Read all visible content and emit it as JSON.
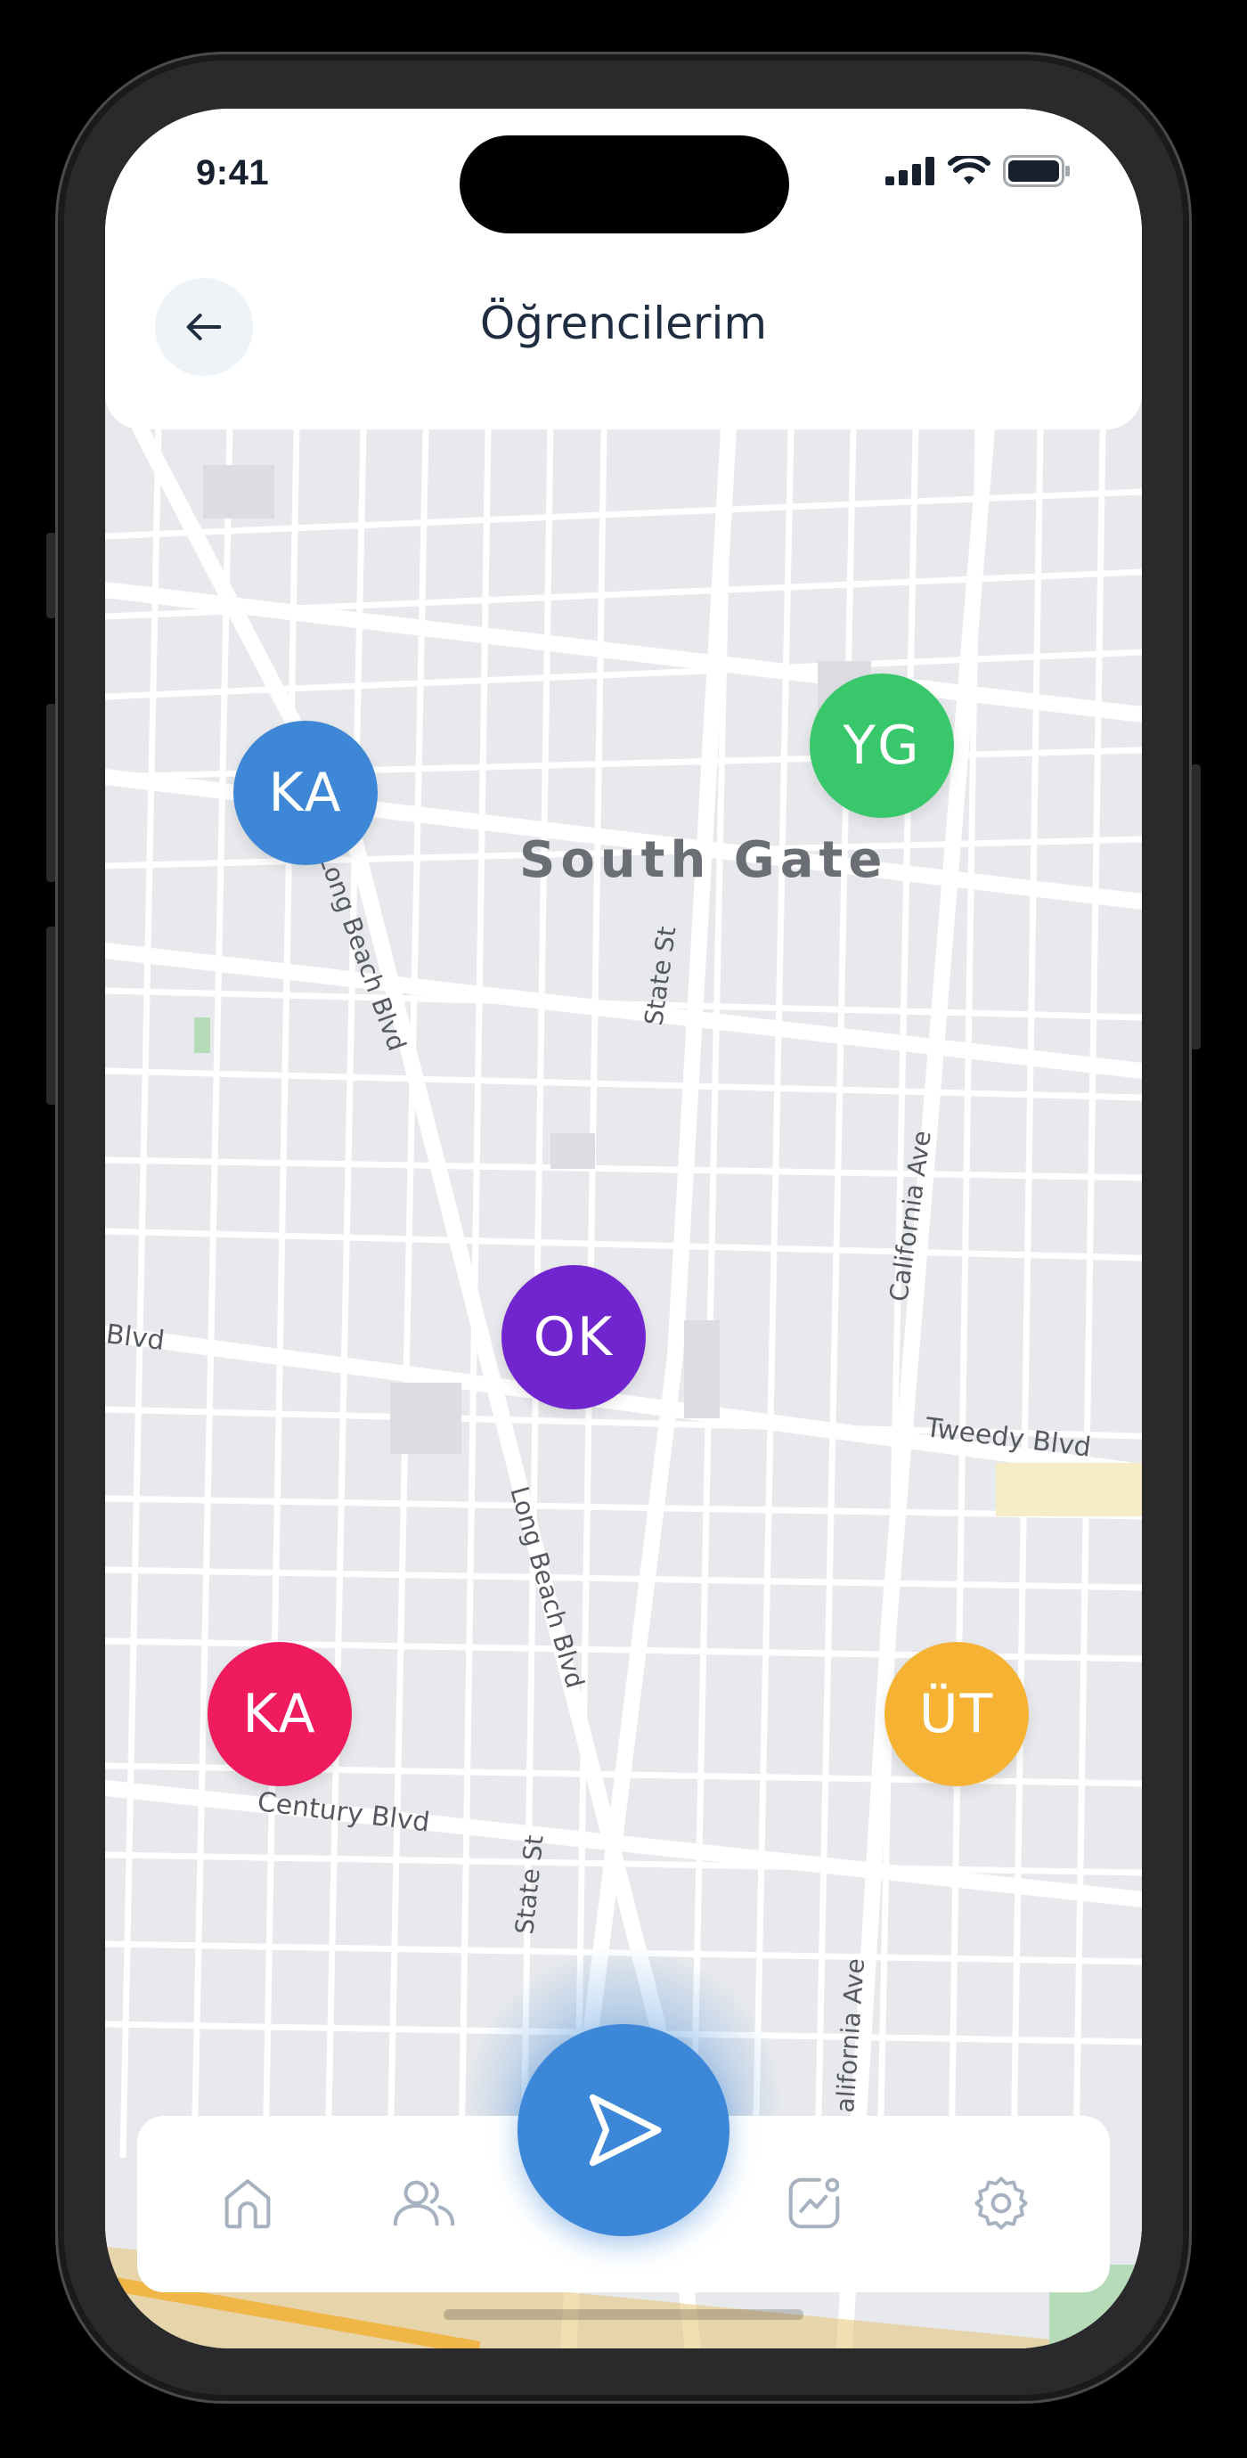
{
  "status_bar": {
    "time": "9:41"
  },
  "header": {
    "title": "Öğrencilerim"
  },
  "map": {
    "area_label": "South Gate",
    "street_labels": {
      "long_beach_1": "Long Beach Blvd",
      "long_beach_2": "Long Beach Blvd",
      "state_st_1": "State St",
      "state_st_2": "State St",
      "california_1": "California Ave",
      "california_2": "alifornia Ave",
      "tweedy": "Tweedy Blvd",
      "century": "Century Blvd",
      "blvd_left": "Blvd"
    }
  },
  "students": [
    {
      "initials": "KA",
      "color": "#3e87d6"
    },
    {
      "initials": "YG",
      "color": "#38c76a"
    },
    {
      "initials": "OK",
      "color": "#7125cf"
    },
    {
      "initials": "KA",
      "color": "#f01a5e"
    },
    {
      "initials": "ÜT",
      "color": "#f6b333"
    }
  ],
  "nav": {
    "items": [
      {
        "icon": "home-icon"
      },
      {
        "icon": "users-icon"
      },
      {
        "icon": "send-icon"
      },
      {
        "icon": "chart-icon"
      },
      {
        "icon": "gear-icon"
      }
    ],
    "accent": "#3d87d8"
  }
}
